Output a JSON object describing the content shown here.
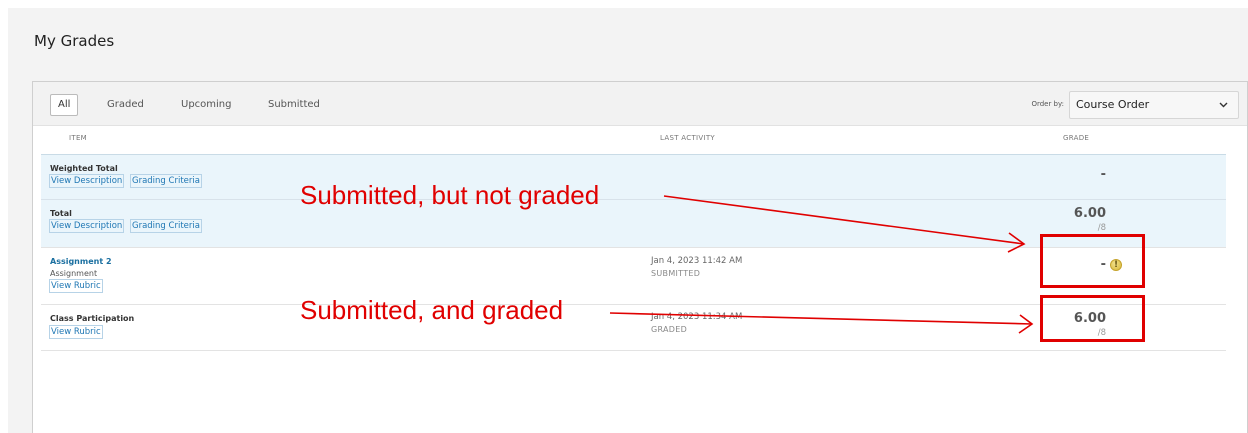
{
  "page": {
    "title": "My Grades"
  },
  "filters": {
    "tabs": [
      {
        "label": "All",
        "active": true
      },
      {
        "label": "Graded",
        "active": false
      },
      {
        "label": "Upcoming",
        "active": false
      },
      {
        "label": "Submitted",
        "active": false
      }
    ],
    "order_by_label": "Order by:",
    "order_by_value": "Course Order",
    "order_by_icon": "chevron-down-icon"
  },
  "columns": {
    "item": "ITEM",
    "last_activity": "LAST ACTIVITY",
    "grade": "GRADE"
  },
  "rows": [
    {
      "title": "Weighted Total",
      "actions": [
        "View Description",
        "Grading Criteria"
      ],
      "grade": "-"
    },
    {
      "title": "Total",
      "actions": [
        "View Description",
        "Grading Criteria"
      ],
      "grade": "6.00",
      "grade_out_of": "/8"
    },
    {
      "title": "Assignment 2",
      "subtitle": "Assignment",
      "actions": [
        "View Rubric"
      ],
      "activity_date": "Jan 4, 2023 11:42 AM",
      "activity_status": "SUBMITTED",
      "grade": "-",
      "status_icon": "needs-grading-icon"
    },
    {
      "title": "Class Participation",
      "actions": [
        "View Rubric"
      ],
      "activity_date": "Jan 4, 2023 11:34 AM",
      "activity_status": "GRADED",
      "grade": "6.00",
      "grade_out_of": "/8"
    }
  ],
  "annotations": {
    "not_graded": "Submitted, but not graded",
    "graded": "Submitted, and graded",
    "color": "#e00000"
  },
  "colors": {
    "link": "#1f77b4",
    "summary_row_bg": "#eaf5fb",
    "page_bg": "#f3f3f3"
  }
}
